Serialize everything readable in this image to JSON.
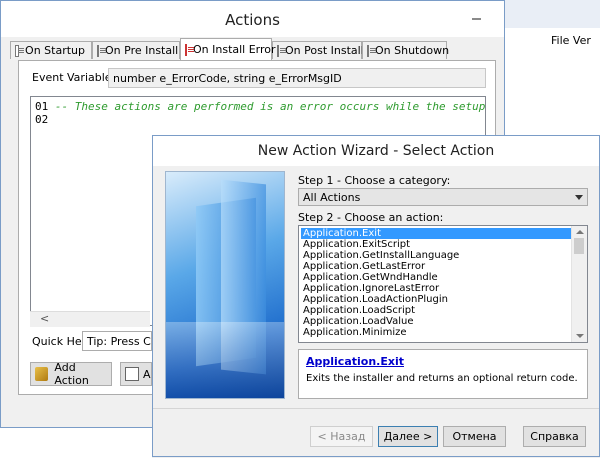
{
  "background": {
    "column_header": "File Ver"
  },
  "actions_window": {
    "title": "Actions",
    "tabs": [
      {
        "label": "On Startup"
      },
      {
        "label": "On Pre Install"
      },
      {
        "label": "On Install Error"
      },
      {
        "label": "On Post Install"
      },
      {
        "label": "On Shutdown"
      }
    ],
    "active_tab": "On Install Error",
    "event_variables_label": "Event Variables:",
    "event_variables_value": "number e_ErrorCode, string e_ErrorMsgID",
    "code": {
      "line1_number": "01",
      "line1_text": "-- These actions are performed is an error occurs while the setup is",
      "line2_number": "02"
    },
    "hscroll_arrow": "<",
    "quick_help_label": "Quick Help:",
    "quick_help_value": "Tip: Press Ctrl+",
    "add_action_label": "Add Action",
    "second_button_label": "A"
  },
  "wizard": {
    "title": "New Action Wizard - Select Action",
    "step1_label": "Step 1 - Choose a category:",
    "category_value": "All Actions",
    "step2_label": "Step 2 - Choose an action:",
    "actions": [
      "Application.Exit",
      "Application.ExitScript",
      "Application.GetInstallLanguage",
      "Application.GetLastError",
      "Application.GetWndHandle",
      "Application.IgnoreLastError",
      "Application.LoadActionPlugin",
      "Application.LoadScript",
      "Application.LoadValue",
      "Application.Minimize"
    ],
    "selected_action": "Application.Exit",
    "description_title": "Application.Exit",
    "description_text": "Exits the installer and returns an optional return code.",
    "buttons": {
      "back": "< Назад",
      "next": "Далее >",
      "cancel": "Отмена",
      "help": "Справка"
    }
  }
}
